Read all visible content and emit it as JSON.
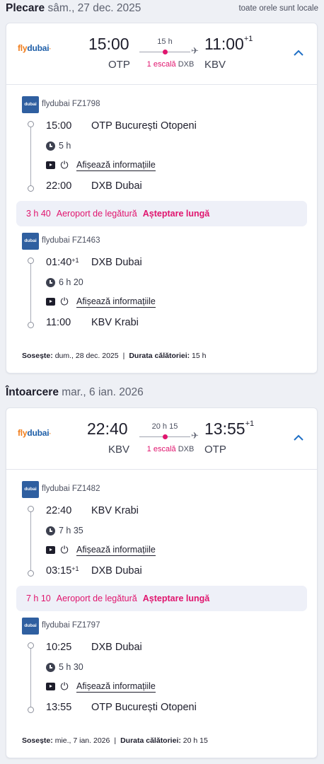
{
  "timezone_note": "toate orele sunt locale",
  "outbound": {
    "direction_label": "Plecare",
    "date": "sâm., 27 dec. 2025",
    "airline_logo": {
      "fly": "fly",
      "dubai": "dubai",
      "dot": "·"
    },
    "dep_time": "15:00",
    "arr_time": "11:00",
    "arr_day_offset": "+1",
    "dep_iata": "OTP",
    "arr_iata": "KBV",
    "total_duration": "15 h",
    "stops_label": "1 escală",
    "stop_hub": "DXB",
    "segments": [
      {
        "carrier_badge": "dubai",
        "carrier": "flydubai FZ1798",
        "dep_time": "15:00",
        "dep_offset": "",
        "dep_place": "OTP București Otopeni",
        "duration": "5 h",
        "amenities_link": "Afișează informațiile",
        "arr_time": "22:00",
        "arr_offset": "",
        "arr_place": "DXB Dubai"
      },
      {
        "carrier_badge": "dubai",
        "carrier": "flydubai FZ1463",
        "dep_time": "01:40",
        "dep_offset": "+1",
        "dep_place": "DXB Dubai",
        "duration": "6 h 20",
        "amenities_link": "Afișează informațiile",
        "arr_time": "11:00",
        "arr_offset": "",
        "arr_place": "KBV Krabi"
      }
    ],
    "layover": {
      "duration": "3 h 40",
      "label": "Aeroport de legătură",
      "tag": "Așteptare lungă"
    },
    "arrives_label": "Sosește:",
    "arrives_value": "dum., 28 dec. 2025",
    "separator": "|",
    "trip_duration_label": "Durata călătoriei:",
    "trip_duration_value": "15 h"
  },
  "inbound": {
    "direction_label": "Întoarcere",
    "date": "mar., 6 ian. 2026",
    "airline_logo": {
      "fly": "fly",
      "dubai": "dubai",
      "dot": "·"
    },
    "dep_time": "22:40",
    "arr_time": "13:55",
    "arr_day_offset": "+1",
    "dep_iata": "KBV",
    "arr_iata": "OTP",
    "total_duration": "20 h 15",
    "stops_label": "1 escală",
    "stop_hub": "DXB",
    "segments": [
      {
        "carrier_badge": "dubai",
        "carrier": "flydubai FZ1482",
        "dep_time": "22:40",
        "dep_offset": "",
        "dep_place": "KBV Krabi",
        "duration": "7 h 35",
        "amenities_link": "Afișează informațiile",
        "arr_time": "03:15",
        "arr_offset": "+1",
        "arr_place": "DXB Dubai"
      },
      {
        "carrier_badge": "dubai",
        "carrier": "flydubai FZ1797",
        "dep_time": "10:25",
        "dep_offset": "",
        "dep_place": "DXB Dubai",
        "duration": "5 h 30",
        "amenities_link": "Afișează informațiile",
        "arr_time": "13:55",
        "arr_offset": "",
        "arr_place": "OTP București Otopeni"
      }
    ],
    "layover": {
      "duration": "7 h 10",
      "label": "Aeroport de legătură",
      "tag": "Așteptare lungă"
    },
    "arrives_label": "Sosește:",
    "arrives_value": "mie., 7 ian. 2026",
    "separator": "|",
    "trip_duration_label": "Durata călătoriei:",
    "trip_duration_value": "20 h 15"
  },
  "icons": {
    "clock": "clock-icon",
    "entertainment": "tv-icon",
    "power": "plug-icon",
    "plane": "plane-icon",
    "collapse": "chevron-up-icon"
  },
  "colors": {
    "accent_pink": "#e0156e",
    "link_blue": "#1f6fc5",
    "logo_orange": "#f07d1c",
    "logo_blue": "#1f5fa8",
    "layover_bg": "#eef0f8"
  }
}
